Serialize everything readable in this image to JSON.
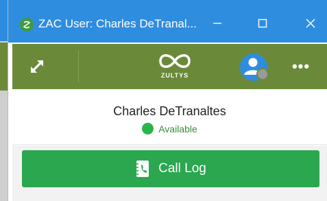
{
  "window": {
    "title": "ZAC User: Charles DeTranal...",
    "colors": {
      "titlebar": "#2f8de0",
      "toolbar": "#6a8a3a",
      "accent_green": "#2aa74f"
    }
  },
  "toolbar": {
    "expand_icon": "expand-icon",
    "logo_text": "ZULTYS",
    "avatar_icon": "user-avatar-icon",
    "more_label": "•••"
  },
  "user": {
    "name": "Charles DeTranaltes",
    "status": "Available",
    "status_color": "#2bb44a"
  },
  "actions": {
    "call_log_label": "Call Log",
    "call_log_icon": "phone-book-icon"
  }
}
